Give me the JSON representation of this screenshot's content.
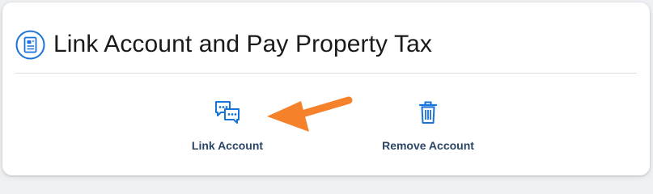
{
  "page": {
    "title": "Link Account and Pay Property Tax",
    "header_icon": "document-icon"
  },
  "actions": [
    {
      "label": "Link Account",
      "icon": "chat-bubbles-icon"
    },
    {
      "label": "Remove Account",
      "icon": "trash-icon"
    }
  ],
  "annotation": {
    "icon": "arrow-icon",
    "color": "#f5822a"
  },
  "colors": {
    "accent": "#1a73d9",
    "label": "#2b4566",
    "title": "#1a1a1a"
  }
}
